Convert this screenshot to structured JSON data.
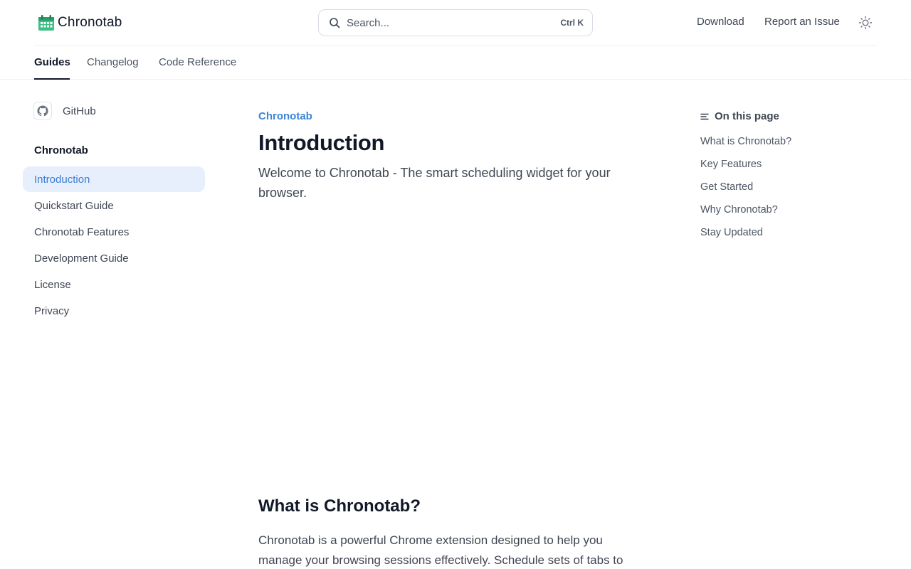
{
  "header": {
    "logo_text": "Chronotab",
    "search": {
      "placeholder": "Search...",
      "shortcut": "Ctrl K"
    },
    "links": [
      "Download",
      "Report an Issue"
    ],
    "theme_icon": "sun-icon"
  },
  "tabs": [
    {
      "label": "Guides",
      "active": true
    },
    {
      "label": "Changelog",
      "active": false
    },
    {
      "label": "Code Reference",
      "active": false
    }
  ],
  "sidebar": {
    "github_label": "GitHub",
    "section_heading": "Chronotab",
    "items": [
      {
        "label": "Introduction",
        "active": true
      },
      {
        "label": "Quickstart Guide",
        "active": false
      },
      {
        "label": "Chronotab Features",
        "active": false
      },
      {
        "label": "Development Guide",
        "active": false
      },
      {
        "label": "License",
        "active": false
      },
      {
        "label": "Privacy",
        "active": false
      }
    ]
  },
  "main": {
    "breadcrumb": "Chronotab",
    "title": "Introduction",
    "lead": "Welcome to Chronotab - The smart scheduling widget for your browser.",
    "section_heading": "What is Chronotab?",
    "section_text": "Chronotab is a powerful Chrome extension designed to help you manage your browsing sessions effectively. Schedule sets of tabs to"
  },
  "toc": {
    "title": "On this page",
    "items": [
      "What is Chronotab?",
      "Key Features",
      "Get Started",
      "Why Chronotab?",
      "Stay Updated"
    ]
  },
  "colors": {
    "accent": "#3b86d6",
    "active_bg": "#e8effc",
    "logo_green": "#2fb27a"
  }
}
